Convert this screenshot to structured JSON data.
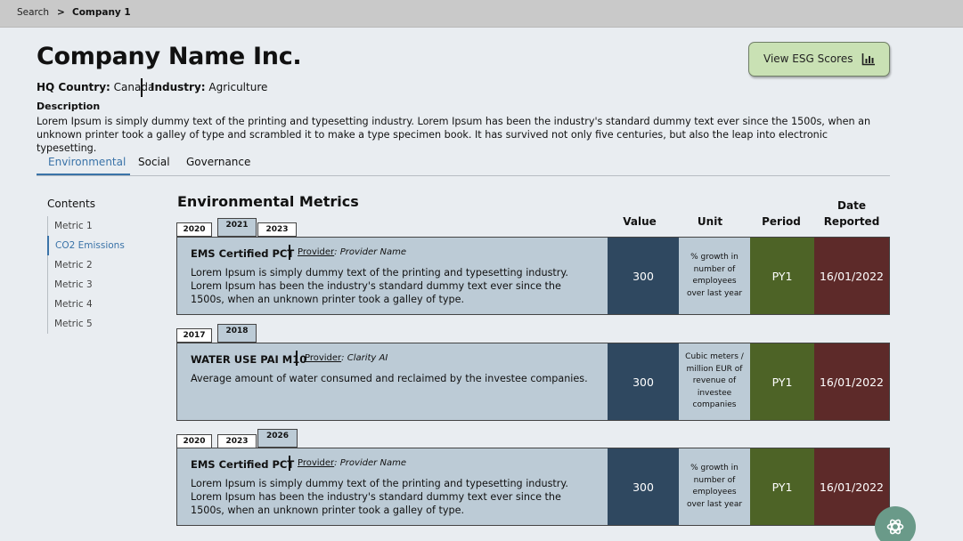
{
  "breadcrumb": {
    "search": "Search",
    "separator": ">",
    "current": "Company 1"
  },
  "company": {
    "name": "Company Name Inc.",
    "hq_label": "HQ Country:",
    "hq_value": " Canada",
    "industry_label": "Industry:",
    "industry_value": " Agriculture",
    "description_heading": "Description",
    "description": "Lorem Ipsum is simply dummy text of the printing and typesetting industry. Lorem Ipsum has been the industry's standard dummy text ever since the 1500s, when an unknown printer took a galley of type and scrambled it to make a type specimen book. It has survived not only five centuries, but also the leap into electronic typesetting."
  },
  "esg_button": {
    "label": "View ESG Scores",
    "icon": "bar-chart-icon"
  },
  "tabs": [
    "Environmental",
    "Social",
    "Governance"
  ],
  "contents": {
    "heading": "Contents",
    "items": [
      "Metric 1",
      "CO2 Emissions",
      "Metric 2",
      "Metric 3",
      "Metric 4",
      "Metric 5"
    ],
    "active_index": 1
  },
  "metrics_heading": "Environmental Metrics",
  "columns": {
    "value": "Value",
    "unit": "Unit",
    "period": "Period",
    "date": "Date Reported"
  },
  "cards": [
    {
      "years": [
        "2020",
        "2021",
        "2023"
      ],
      "selected_year": "2021",
      "name": "EMS Certified PCT",
      "provider_label": "Provider",
      "provider": ": Provider Name",
      "description": "Lorem Ipsum is simply dummy text of the printing and typesetting industry. Lorem Ipsum has been the industry's standard dummy text ever since the 1500s, when an unknown printer took a galley of type.",
      "value": "300",
      "unit": "% growth in number of employees over last year",
      "period": "PY1",
      "date": "16/01/2022"
    },
    {
      "years": [
        "2017",
        "2018"
      ],
      "selected_year": "2018",
      "name": "WATER USE PAI M10",
      "provider_label": "Provider",
      "provider": ": Clarity AI",
      "description": "Average amount of water consumed and reclaimed by the investee companies.",
      "value": "300",
      "unit": "Cubic meters / million EUR of revenue of investee companies",
      "period": "PY1",
      "date": "16/01/2022"
    },
    {
      "years": [
        "2020",
        "2023",
        "2026"
      ],
      "selected_year": "2026",
      "name": "EMS Certified PCT",
      "provider_label": "Provider",
      "provider": ": Provider Name",
      "description": "Lorem Ipsum is simply dummy text of the printing and typesetting industry. Lorem Ipsum has been the industry's standard dummy text ever since the 1500s, when an unknown printer took a galley of type.",
      "value": "300",
      "unit": "% growth in number of employees over last year",
      "period": "PY1",
      "date": "16/01/2022"
    }
  ],
  "chat_button": {
    "icon": "chat-assistant-icon"
  },
  "colors": {
    "accent": "#3a73a8",
    "value_bg": "#2f4860",
    "period_bg": "#4d6326",
    "date_bg": "#5d2a29",
    "card_bg": "#bccbd6",
    "esg_button_bg": "#c9e1b4"
  }
}
